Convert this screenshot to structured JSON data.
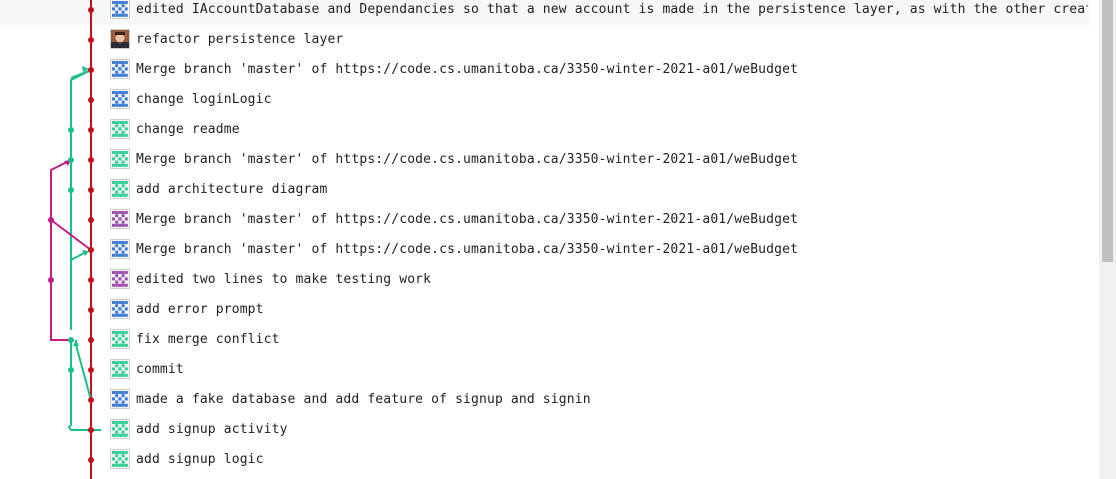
{
  "commits": [
    {
      "message": "edited IAccountDatabase and Dependancies so that a new account is made in the persistence layer, as with the other creation t",
      "avatar": "identicon-blue"
    },
    {
      "message": "refactor persistence layer",
      "avatar": "photo"
    },
    {
      "message": "Merge branch 'master' of https://code.cs.umanitoba.ca/3350-winter-2021-a01/weBudget",
      "avatar": "identicon-blue"
    },
    {
      "message": "change loginLogic",
      "avatar": "identicon-blue"
    },
    {
      "message": "change readme",
      "avatar": "identicon-teal"
    },
    {
      "message": "Merge branch 'master' of https://code.cs.umanitoba.ca/3350-winter-2021-a01/weBudget",
      "avatar": "identicon-teal"
    },
    {
      "message": "add architecture diagram",
      "avatar": "identicon-teal"
    },
    {
      "message": "Merge branch 'master' of https://code.cs.umanitoba.ca/3350-winter-2021-a01/weBudget",
      "avatar": "identicon-purple"
    },
    {
      "message": "Merge branch 'master' of https://code.cs.umanitoba.ca/3350-winter-2021-a01/weBudget",
      "avatar": "identicon-blue"
    },
    {
      "message": "edited two lines to make testing work",
      "avatar": "identicon-purple"
    },
    {
      "message": "add error prompt",
      "avatar": "identicon-blue"
    },
    {
      "message": "fix merge conflict",
      "avatar": "identicon-teal"
    },
    {
      "message": "commit",
      "avatar": "identicon-teal"
    },
    {
      "message": "made a fake database and add feature of signup and signin",
      "avatar": "identicon-blue"
    },
    {
      "message": "add signup activity",
      "avatar": "identicon-teal"
    },
    {
      "message": "add signup logic",
      "avatar": "identicon-teal"
    }
  ],
  "colors": {
    "main_branch": "#c4101e",
    "teal_branch": "#1bbf8a",
    "magenta_branch": "#c01c84",
    "avatar_blue": "#3a7bd5",
    "avatar_teal": "#2fcf96",
    "avatar_purple": "#9b4fb0"
  }
}
